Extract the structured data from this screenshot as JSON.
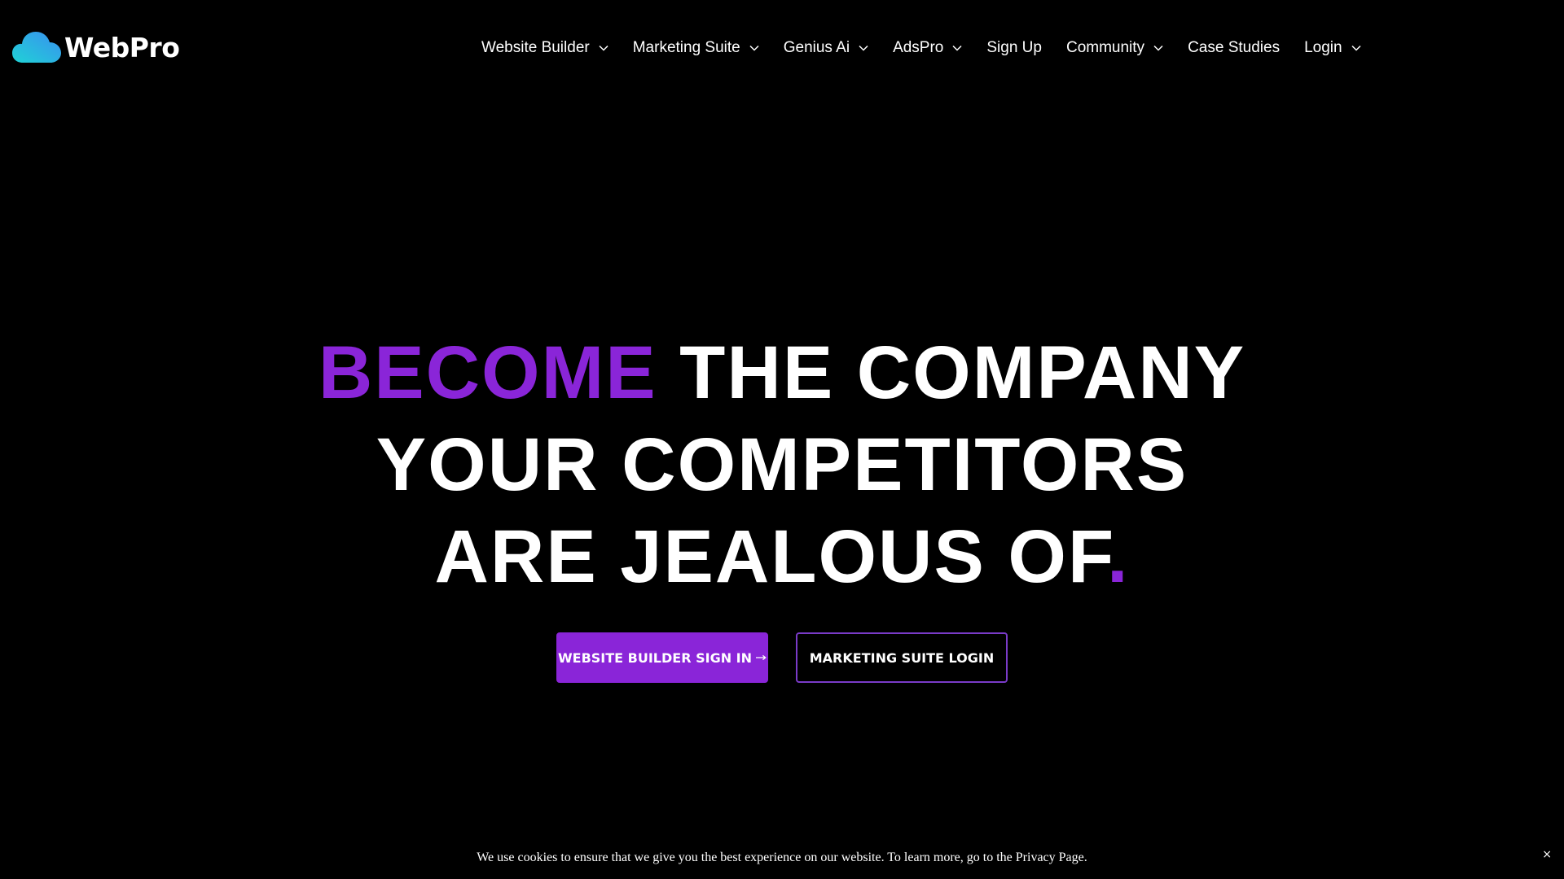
{
  "header": {
    "logo_text": "WebPro",
    "logo_icon": "cloud-icon",
    "nav": [
      {
        "label": "Website Builder",
        "has_dropdown": true
      },
      {
        "label": "Marketing Suite",
        "has_dropdown": true
      },
      {
        "label": "Genius Ai",
        "has_dropdown": true
      },
      {
        "label": "AdsPro",
        "has_dropdown": true
      },
      {
        "label": "Sign Up",
        "has_dropdown": false
      },
      {
        "label": "Community",
        "has_dropdown": true
      },
      {
        "label": "Case Studies",
        "has_dropdown": false
      },
      {
        "label": "Login",
        "has_dropdown": true
      }
    ]
  },
  "hero": {
    "line1_accent": "BECOME",
    "line1_rest": " THE COMPANY",
    "line2": "YOUR COMPETITORS",
    "line3": "ARE JEALOUS OF",
    "line3_accent": "."
  },
  "cta": {
    "primary_label": "WEBSITE BUILDER SIGN IN",
    "primary_icon": "arrow-right-icon",
    "secondary_label": "MARKETING SUITE LOGIN"
  },
  "cookie": {
    "text": "We use cookies to ensure that we give you the best experience on our website. To learn more, go to the Privacy Page.",
    "close_label": "×"
  },
  "colors": {
    "background": "#000000",
    "accent": "#8a25d8",
    "text": "#ffffff",
    "logo_cyan": "#1fd3d6",
    "logo_blue": "#3a8ff0"
  }
}
